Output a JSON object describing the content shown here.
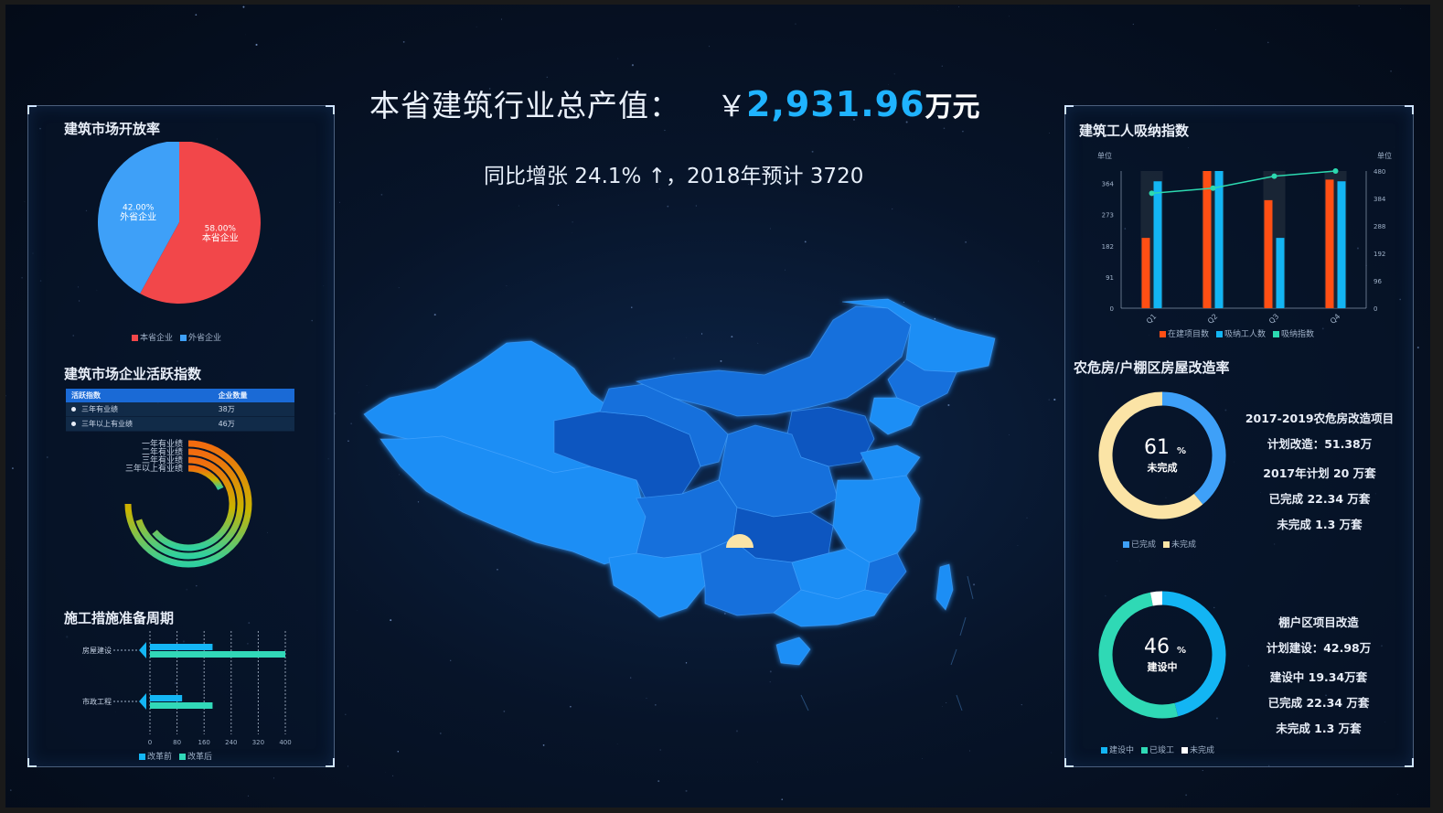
{
  "header": {
    "title_label": "本省建筑行业总产值：",
    "currency": "￥",
    "total_value": "2,931.96",
    "unit": "万元",
    "subtitle": "同比增张 24.1% ↑，2018年预计 3720"
  },
  "left_panel": {
    "open_rate": {
      "title": "建筑市场开放率",
      "chart_data": {
        "type": "pie",
        "slices": [
          {
            "name": "本省企业",
            "value": 58.0,
            "label": "58.00%",
            "color": "#f2474a"
          },
          {
            "name": "外省企业",
            "value": 42.0,
            "label": "42.00%",
            "color": "#3ea0f8"
          }
        ],
        "legend": [
          "本省企业",
          "外省企业"
        ]
      }
    },
    "activity": {
      "title": "建筑市场企业活跃指数",
      "table": {
        "headers": [
          "活跃指数",
          "企业数量"
        ],
        "rows": [
          [
            "三年有业绩",
            "38万"
          ],
          [
            "三年以上有业绩",
            "46万"
          ]
        ]
      },
      "chart_data": {
        "type": "bar",
        "subtype": "radial",
        "categories": [
          "一年有业绩",
          "二年有业绩",
          "三年有业绩",
          "三年以上有业绩"
        ],
        "values": [
          75,
          70,
          64,
          18
        ],
        "colors": [
          "#f26b0f",
          "#d9a500",
          "#6dcd5b",
          "#27c7a5"
        ]
      }
    },
    "prep_cycle": {
      "title": "施工措施准备周期",
      "chart_data": {
        "type": "bar",
        "orientation": "horizontal",
        "categories": [
          "房屋建设",
          "市政工程"
        ],
        "series": [
          {
            "name": "改革前",
            "values": [
              185,
              95
            ],
            "color": "#14b6f5"
          },
          {
            "name": "改革后",
            "values": [
              400,
              185
            ],
            "color": "#31d8b8"
          }
        ],
        "xticks": [
          0,
          80,
          160,
          240,
          320,
          400
        ],
        "xlim": [
          0,
          400
        ]
      }
    }
  },
  "right_panel": {
    "workers": {
      "title": "建筑工人吸纳指数",
      "chart_data": {
        "type": "bar",
        "categories": [
          "Q1",
          "Q2",
          "Q3",
          "Q4"
        ],
        "series": [
          {
            "name": "在建项目数",
            "values": [
              205,
              400,
              315,
              375
            ],
            "color": "#ff4f14"
          },
          {
            "name": "吸纳工人数",
            "values": [
              370,
              400,
              205,
              370
            ],
            "color": "#13b5f3"
          },
          {
            "name": "吸纳指数",
            "values": [
              335,
              350,
              385,
              400
            ],
            "color": "#2cd9b0",
            "kind": "line"
          }
        ],
        "ylabel_left": "单位",
        "ylabel_right": "单位",
        "yticks_left": [
          "0",
          "91",
          "182",
          "273",
          "364"
        ],
        "yticks_right": [
          "0",
          "96",
          "192",
          "288",
          "384",
          "480"
        ],
        "ylim": [
          0,
          400
        ]
      }
    },
    "renovation": {
      "title": "农危房/户棚区房屋改造率",
      "donut1": {
        "percent": "61",
        "pct_sign": "%",
        "status": "未完成",
        "chart_data": {
          "type": "pie",
          "subtype": "donut",
          "slices": [
            {
              "name": "已完成",
              "value": 39,
              "color": "#3ea0f8"
            },
            {
              "name": "未完成",
              "value": 61,
              "color": "#fbe4a6"
            }
          ]
        },
        "legend": [
          "已完成",
          "未完成"
        ],
        "info": {
          "line1": "2017-2019农危房改造项目",
          "line2": "计划改造：51.38万",
          "line3": "2017年计划 20 万套",
          "line4": "已完成 22.34 万套",
          "line5": "未完成 1.3 万套"
        }
      },
      "donut2": {
        "percent": "46",
        "pct_sign": "%",
        "status": "建设中",
        "chart_data": {
          "type": "pie",
          "subtype": "donut",
          "slices": [
            {
              "name": "建设中",
              "value": 46,
              "color": "#13b5f3"
            },
            {
              "name": "已竣工",
              "value": 51,
              "color": "#2fd9b5"
            },
            {
              "name": "未完成",
              "value": 3,
              "color": "#ffffff"
            }
          ]
        },
        "legend": [
          "建设中",
          "已竣工",
          "未完成"
        ],
        "info": {
          "line1": "棚户区项目改造",
          "line2": "计划建设：42.98万",
          "line3": "建设中 19.34万套",
          "line4": "已完成 22.34 万套",
          "line5": "未完成 1.3 万套"
        }
      }
    }
  },
  "colors": {
    "accent": "#1fb3ff",
    "map_light": "#1e8ef5",
    "map_mid": "#1670dc",
    "map_dark": "#0f56c0"
  }
}
